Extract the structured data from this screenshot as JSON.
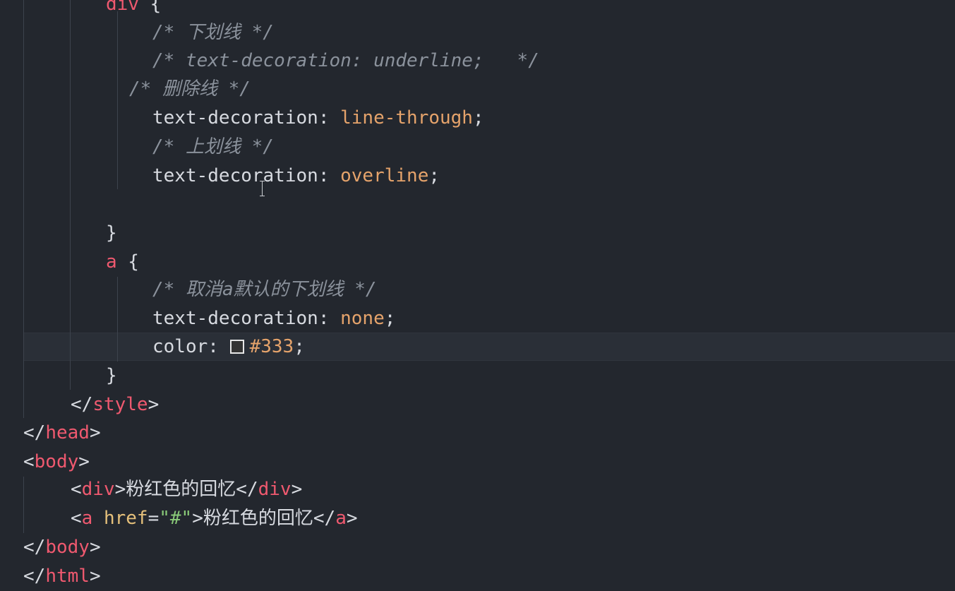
{
  "editor": {
    "lines": {
      "l1": {
        "tag": "div",
        "punct": " {"
      },
      "l2": {
        "comment": "/* 下划线 */"
      },
      "l3": {
        "comment": "/* text-decoration: underline;   */"
      },
      "l4": {
        "comment": "/* 删除线 */"
      },
      "l5": {
        "prop": "text-decoration",
        "colon": ": ",
        "value": "line-through",
        "semi": ";"
      },
      "l6": {
        "comment": "/* 上划线 */"
      },
      "l7": {
        "prop": "text-decoration",
        "colon": ": ",
        "value": "overline",
        "semi": ";"
      },
      "l8": {
        "text": "}"
      },
      "l9": {
        "tag": "a",
        "punct": " {"
      },
      "l10": {
        "comment": "/* 取消a默认的下划线 */"
      },
      "l11": {
        "prop": "text-decoration",
        "colon": ": ",
        "value": "none",
        "semi": ";"
      },
      "l12": {
        "prop": "color",
        "colon": ": ",
        "value": "#333",
        "semi": ";",
        "swatch_color": "#333333"
      },
      "l13": {
        "text": "}"
      },
      "l14": {
        "open": "</",
        "tag": "style",
        "close": ">"
      },
      "l15": {
        "open": "</",
        "tag": "head",
        "close": ">"
      },
      "l16": {
        "open": "<",
        "tag": "body",
        "close": ">"
      },
      "l17": {
        "open": "<",
        "tag": "div",
        "close": ">",
        "text": "粉红色的回忆",
        "open2": "</",
        "tag2": "div",
        "close2": ">"
      },
      "l18": {
        "open": "<",
        "tag": "a",
        "attr": " href",
        "eq": "=",
        "str": "\"#\"",
        "close": ">",
        "text": "粉红色的回忆",
        "open2": "</",
        "tag2": "a",
        "close2": ">"
      },
      "l19": {
        "open": "</",
        "tag": "body",
        "close": ">"
      },
      "l20": {
        "open": "</",
        "tag": "html",
        "close": ">"
      }
    }
  },
  "colors": {
    "background": "#23272e",
    "tag": "#ef596f",
    "value": "#e5a36b",
    "attribute": "#e5c07b",
    "string": "#89ca78",
    "comment": "#8b929c",
    "text": "#d7dae0"
  }
}
